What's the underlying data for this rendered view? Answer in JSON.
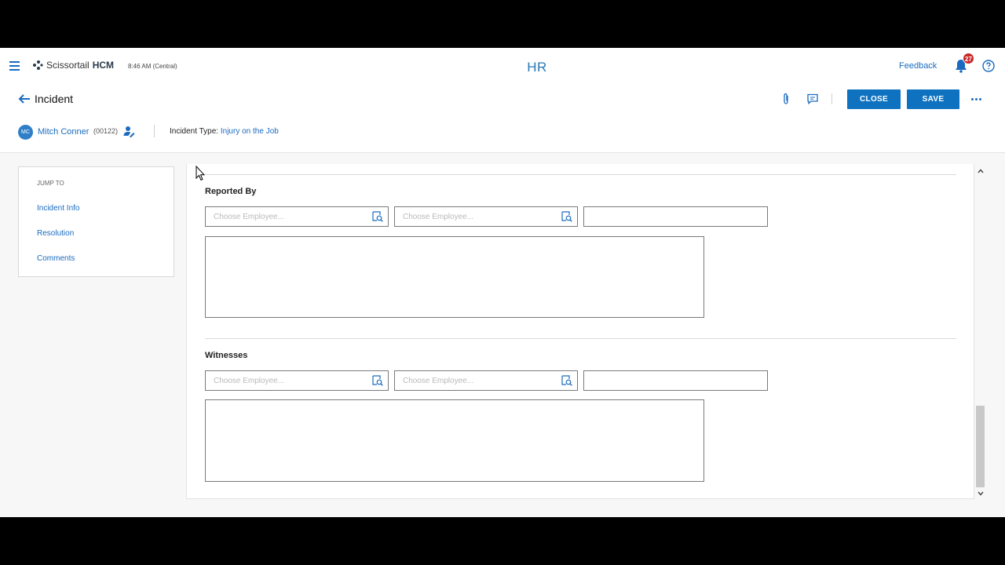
{
  "header": {
    "brand_name": "Scissortail",
    "brand_suffix": "HCM",
    "clock": "8:46 AM (Central)",
    "module": "HR",
    "feedback_label": "Feedback",
    "notification_count": "27"
  },
  "page": {
    "title": "Incident",
    "close_label": "CLOSE",
    "save_label": "SAVE"
  },
  "employee": {
    "initials": "MC",
    "name": "Mitch Conner",
    "id": "(00122)",
    "incident_type_label": "Incident Type:",
    "incident_type_value": "Injury on the Job"
  },
  "jump_to": {
    "label": "JUMP TO",
    "links": [
      "Incident Info",
      "Resolution",
      "Comments"
    ]
  },
  "sections": {
    "reported_by": {
      "title": "Reported By",
      "employee_placeholder_1": "Choose Employee...",
      "employee_placeholder_2": "Choose Employee..."
    },
    "witnesses": {
      "title": "Witnesses",
      "employee_placeholder_1": "Choose Employee...",
      "employee_placeholder_2": "Choose Employee..."
    }
  },
  "colors": {
    "accent": "#0f72c0",
    "link": "#1a6bbf",
    "badge": "#c62828"
  },
  "icons": [
    "menu-icon",
    "logo-icon",
    "bell-icon",
    "help-icon",
    "back-arrow-icon",
    "attachment-icon",
    "comment-icon",
    "more-icon",
    "person-edit-icon",
    "lookup-icon",
    "chevron-up-icon",
    "chevron-down-icon"
  ]
}
